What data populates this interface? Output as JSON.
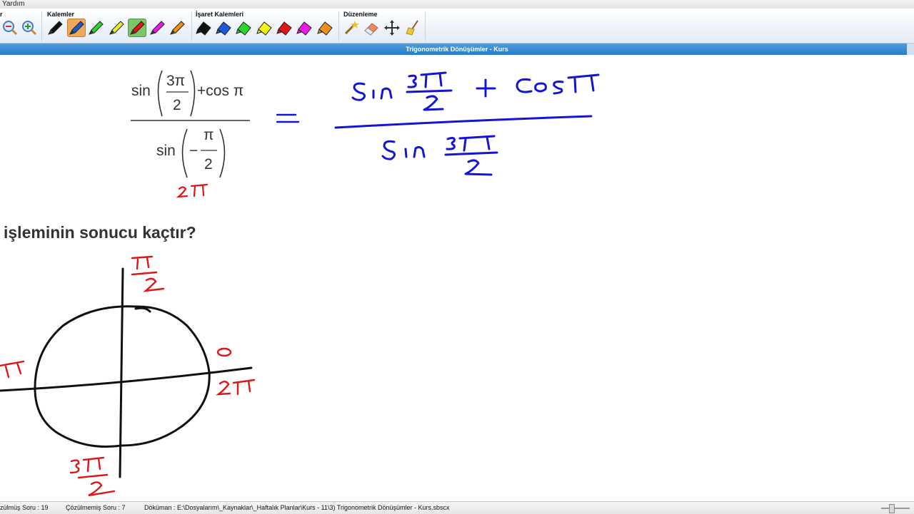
{
  "menubar": {
    "help_label": "Yardım"
  },
  "ribbon": {
    "group_partial_label": "r",
    "groups": {
      "pens": "Kalemler",
      "markers": "İşaret Kalemleri",
      "edit": "Düzenleme"
    }
  },
  "window": {
    "title": "Trigonometrik Dönüşümler - Kurs"
  },
  "content": {
    "question_text": "işleminin sonucu kaçtır?",
    "printed_formula": {
      "numerator_func1": "sin",
      "numerator_frac1_num": "3π",
      "numerator_frac1_den": "2",
      "numerator_plus_cos": "+cos π",
      "denominator_func": "sin",
      "denominator_frac_num": "π",
      "denominator_frac_den": "2",
      "denominator_sign": "−"
    }
  },
  "colors": {
    "ink_blue": "#1414d8",
    "ink_red": "#e01616",
    "ink_black": "#111111",
    "title_bar": "#2a7cc6"
  },
  "icons": [
    "zoom-out-icon",
    "zoom-in-icon",
    "pen-black-icon",
    "pen-blue-icon",
    "pen-green-icon",
    "pen-yellow-icon",
    "pen-red-icon",
    "pen-magenta-icon",
    "pen-orange-icon",
    "marker-black-icon",
    "marker-blue-icon",
    "marker-green-icon",
    "marker-yellow-icon",
    "marker-red-icon",
    "marker-magenta-icon",
    "marker-orange-icon",
    "magic-wand-icon",
    "eraser-icon",
    "move-icon",
    "broom-icon"
  ],
  "statusbar": {
    "solved": "zülmüş Soru : 19",
    "unsolved": "Çözülmemiş Soru : 7",
    "document": "Döküman : E:\\Dosyalarım\\_Kaynaklar\\_Haftalık Planlar\\Kurs - 11\\3) Trigonometrik Dönüşümler - Kurs.sbscx"
  }
}
